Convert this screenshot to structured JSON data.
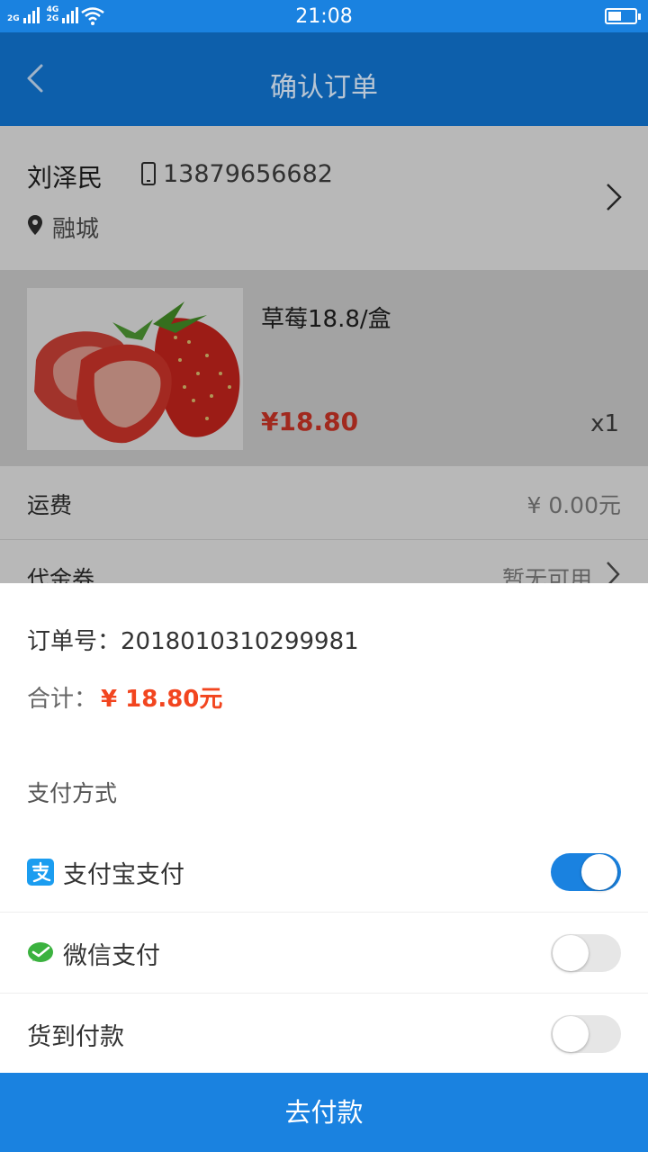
{
  "status_bar": {
    "network_a": "2G",
    "network_b": "4G",
    "network_c": "2G",
    "time": "21:08"
  },
  "header": {
    "title": "确认订单"
  },
  "address": {
    "name": "刘泽民",
    "phone": "13879656682",
    "city": "融城"
  },
  "goods": {
    "name": "草莓18.8/盒",
    "price": "¥18.80",
    "quantity": "x1"
  },
  "fees": {
    "shipping_label": "运费",
    "shipping_value": "¥ 0.00元",
    "coupon_label": "代金券",
    "coupon_value": "暂无可用"
  },
  "sheet": {
    "order_no_label": "订单号：",
    "order_no": "2018010310299981",
    "total_label": "合计：",
    "total_amount": "¥ 18.80元",
    "payment_title": "支付方式",
    "methods": [
      {
        "label": "支付宝支付",
        "icon": "alipay-icon",
        "selected": true
      },
      {
        "label": "微信支付",
        "icon": "wechat-icon",
        "selected": false
      },
      {
        "label": "货到付款",
        "icon": "",
        "selected": false
      }
    ],
    "pay_button": "去付款"
  },
  "colors": {
    "primary": "#1a82e0",
    "header": "#0d5fab",
    "price_red": "#f2451f",
    "alipay": "#1b9df0",
    "wechat": "#3bb23f"
  }
}
